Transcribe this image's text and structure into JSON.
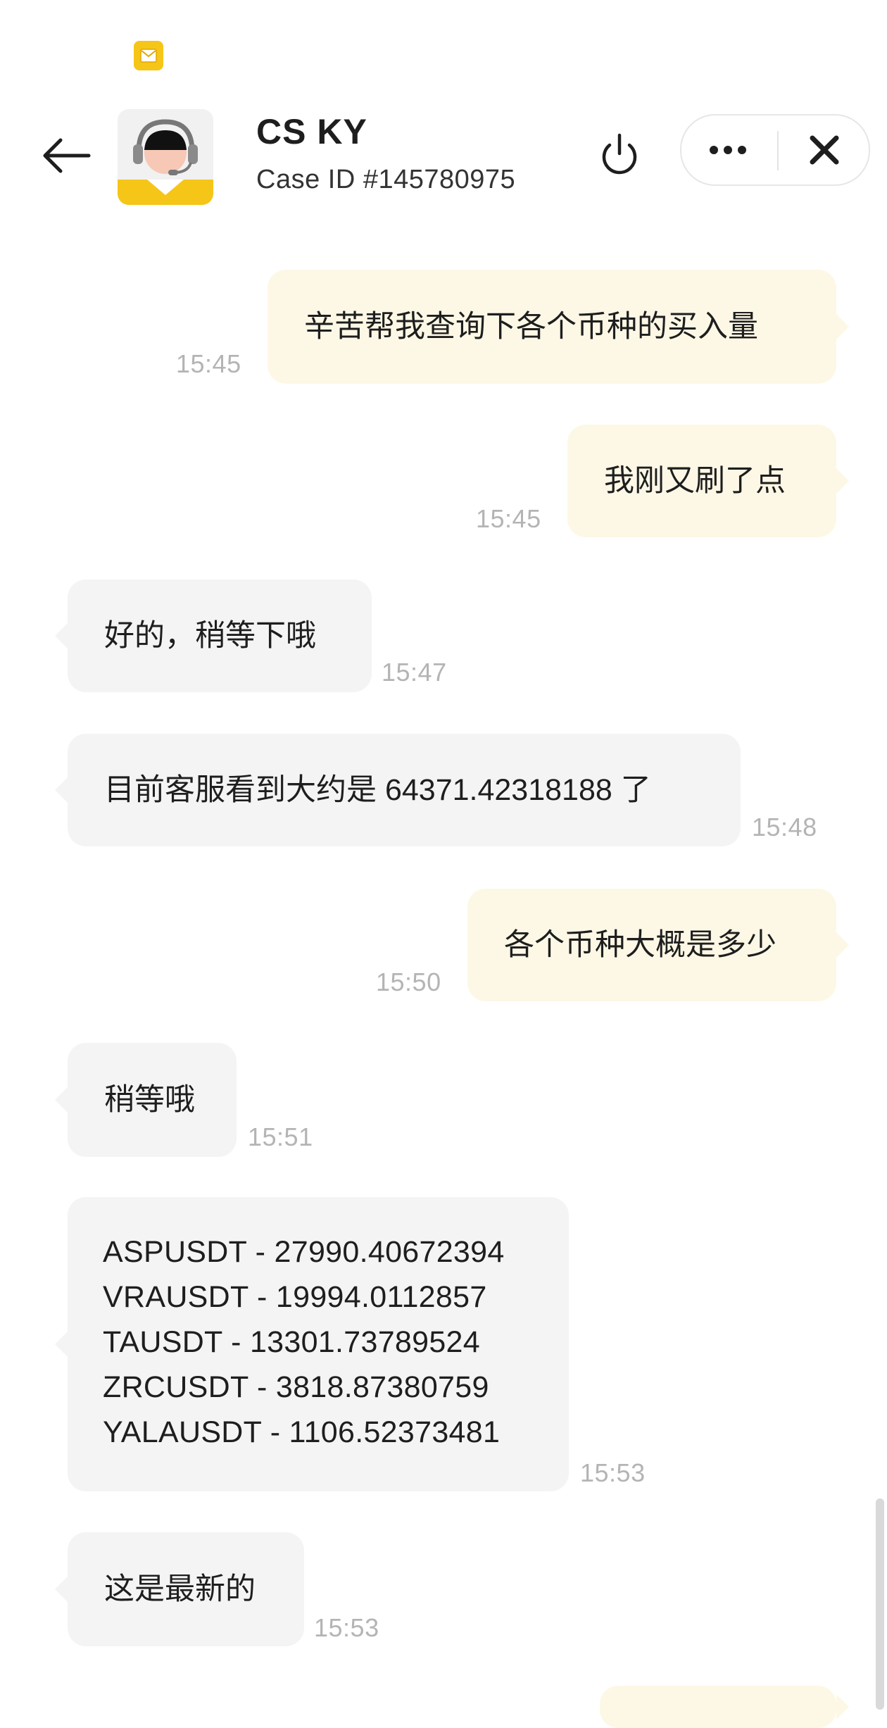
{
  "header": {
    "agent_name": "CS KY",
    "case_id": "Case ID #145780975"
  },
  "icons": {
    "status": "mail-notification-icon",
    "back": "back-arrow-icon",
    "avatar": "support-agent-avatar",
    "power": "power-icon",
    "more": "more-dots-icon",
    "close": "close-icon"
  },
  "colors": {
    "outgoing_bubble": "#fdf8e6",
    "incoming_bubble": "#f4f4f4",
    "accent": "#f5c518",
    "timestamp": "#b4b4b4"
  },
  "messages": [
    {
      "direction": "out",
      "text": "辛苦帮我查询下各个币种的买入量",
      "time": "15:45"
    },
    {
      "direction": "out",
      "text": "我刚又刷了点",
      "time": "15:45"
    },
    {
      "direction": "in",
      "text": "好的，稍等下哦",
      "time": "15:47"
    },
    {
      "direction": "in",
      "text": "目前客服看到大约是 64371.42318188 了",
      "time": "15:48"
    },
    {
      "direction": "out",
      "text": "各个币种大概是多少",
      "time": "15:50"
    },
    {
      "direction": "in",
      "text": "稍等哦",
      "time": "15:51"
    },
    {
      "direction": "in",
      "text": "ASPUSDT - 27990.40672394\nVRAUSDT  - 19994.0112857\nTAUSDT  - 13301.73789524\nZRCUSDT - 3818.87380759\nYALAUSDT - 1106.52373481",
      "time": "15:53"
    },
    {
      "direction": "in",
      "text": "这是最新的",
      "time": "15:53"
    }
  ]
}
